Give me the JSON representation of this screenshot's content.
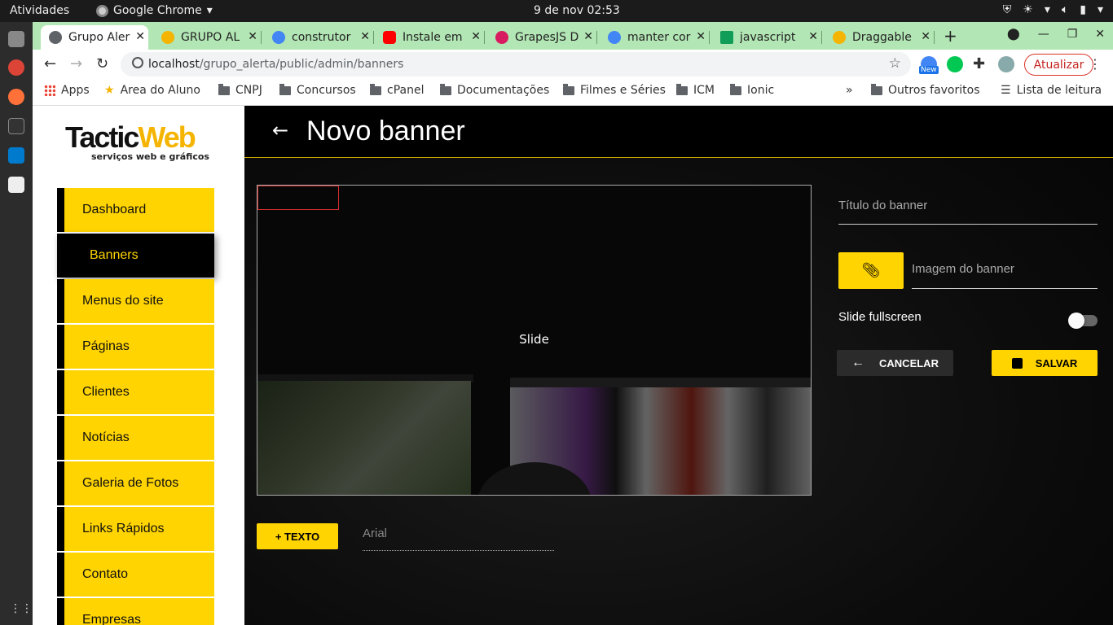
{
  "os": {
    "activities": "Atividades",
    "app_name": "Google Chrome",
    "datetime": "9 de nov  02:53"
  },
  "browser": {
    "tabs": [
      {
        "title": "Grupo Aler",
        "favicon_color": "#5f6368",
        "active": true
      },
      {
        "title": "GRUPO AL",
        "favicon_color": "#f4b400",
        "active": false
      },
      {
        "title": "construtor",
        "favicon_color": "#4285f4",
        "active": false
      },
      {
        "title": "Instale em",
        "favicon_color": "#ff0000",
        "active": false
      },
      {
        "title": "GrapesJS D",
        "favicon_color": "#d81b60",
        "active": false
      },
      {
        "title": "manter cor",
        "favicon_color": "#4285f4",
        "active": false
      },
      {
        "title": "javascript",
        "favicon_color": "#0f9d58",
        "active": false
      },
      {
        "title": "Draggable",
        "favicon_color": "#f4b400",
        "active": false
      }
    ],
    "url_host": "localhost",
    "url_path": "/grupo_alerta/public/admin/banners",
    "update_label": "Atualizar",
    "new_badge": "New",
    "bookmarks": [
      {
        "label": "Apps",
        "icon": "apps-grid-icon"
      },
      {
        "label": "Area do Aluno",
        "icon": "star-icon"
      },
      {
        "label": "CNPJ",
        "icon": "folder-icon"
      },
      {
        "label": "Concursos",
        "icon": "folder-icon"
      },
      {
        "label": "cPanel",
        "icon": "folder-icon"
      },
      {
        "label": "Documentações",
        "icon": "folder-icon"
      },
      {
        "label": "Filmes e Séries",
        "icon": "folder-icon"
      },
      {
        "label": "ICM",
        "icon": "folder-icon"
      },
      {
        "label": "Ionic",
        "icon": "folder-icon"
      }
    ],
    "bookmarks_overflow": "»",
    "other_bookmarks": "Outros favoritos",
    "reading_list": "Lista de leitura"
  },
  "sidebar": {
    "logo_main": "Tactic",
    "logo_accent": "Web",
    "logo_tagline": "serviços web e gráficos",
    "items": [
      {
        "label": "Dashboard",
        "active": false
      },
      {
        "label": "Banners",
        "active": true
      },
      {
        "label": "Menus do site",
        "active": false
      },
      {
        "label": "Páginas",
        "active": false
      },
      {
        "label": "Clientes",
        "active": false
      },
      {
        "label": "Notícias",
        "active": false
      },
      {
        "label": "Galeria de Fotos",
        "active": false
      },
      {
        "label": "Links Rápidos",
        "active": false
      },
      {
        "label": "Contato",
        "active": false
      },
      {
        "label": "Empresas",
        "active": false
      }
    ]
  },
  "page": {
    "title": "Novo banner",
    "slide_label": "Slide",
    "add_text_label": "+ TEXTO",
    "font_value": "Arial",
    "title_placeholder": "Título do banner",
    "image_placeholder": "Imagem do banner",
    "fullscreen_label": "Slide fullscreen",
    "fullscreen_on": false,
    "cancel_label": "CANCELAR",
    "save_label": "SALVAR"
  },
  "colors": {
    "accent": "#ffd400",
    "tabbar": "#b2e6b4",
    "header_border": "#c9a800"
  }
}
